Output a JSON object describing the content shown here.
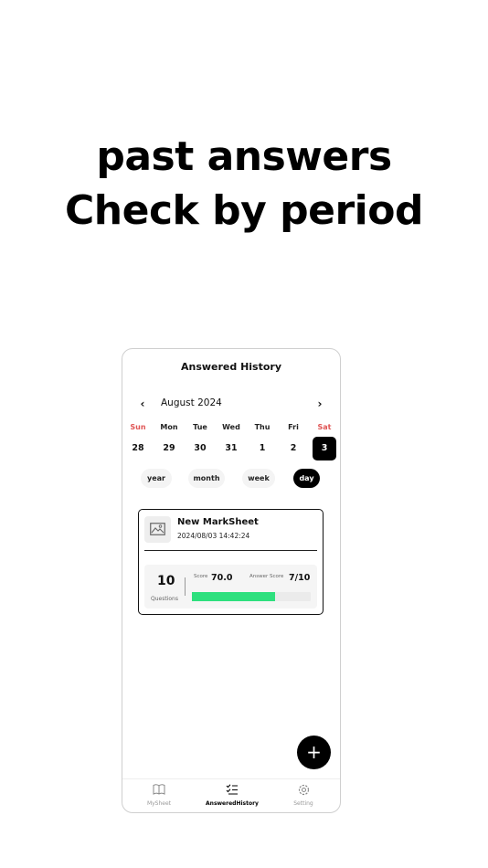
{
  "headline": {
    "line1": "past answers",
    "line2": "Check by period"
  },
  "app": {
    "title": "Answered History",
    "calendar": {
      "month_label": "August 2024",
      "prev_icon": "chevron-left-icon",
      "next_icon": "chevron-right-icon",
      "weekdays": [
        "Sun",
        "Mon",
        "Tue",
        "Wed",
        "Thu",
        "Fri",
        "Sat"
      ],
      "days": [
        "28",
        "29",
        "30",
        "31",
        "1",
        "2",
        "3"
      ],
      "selected_day": "3",
      "weekend_color": "#e05555"
    },
    "periods": [
      "year",
      "month",
      "week",
      "day"
    ],
    "active_period": "day",
    "history_card": {
      "title": "New MarkSheet",
      "date": "2024/08/03 14:42:24",
      "thumbnail_icon": "image-icon",
      "questions_count": "10",
      "questions_label": "Questions",
      "score_label": "Score",
      "score_value": "70.0",
      "answer_score_label": "Answer Score",
      "answer_score_value": "7/10",
      "progress": 0.7,
      "progress_color": "#2ee07e"
    },
    "fab_icon": "plus-icon",
    "tabs": [
      {
        "label": "MySheet",
        "icon": "book-icon"
      },
      {
        "label": "AnsweredHistory",
        "icon": "checklist-icon"
      },
      {
        "label": "Setting",
        "icon": "gear-icon"
      }
    ],
    "active_tab": "AnsweredHistory"
  }
}
